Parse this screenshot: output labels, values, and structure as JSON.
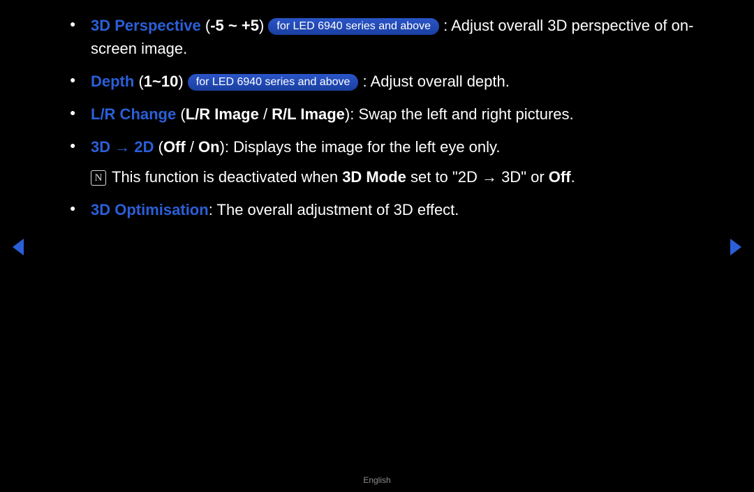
{
  "items": [
    {
      "title": "3D Perspective",
      "range_open": " (",
      "range": "-5 ~ +5",
      "range_close": ") ",
      "badge": "for LED 6940 series and above",
      "colon": " : ",
      "desc": "Adjust overall 3D perspective of on-screen image."
    },
    {
      "title": "Depth",
      "range_open": " (",
      "range": "1~10",
      "range_close": ") ",
      "badge": "for LED 6940 series and above",
      "colon": " : ",
      "desc": "Adjust overall depth."
    },
    {
      "title": "L/R Change",
      "paren_open": " (",
      "opt1": "L/R Image",
      "slash": " / ",
      "opt2": "R/L Image",
      "paren_close": "): ",
      "desc": "Swap the left and right pictures."
    },
    {
      "title": "3D → 2D",
      "paren_open": " (",
      "opt1": "Off",
      "slash": " / ",
      "opt2": "On",
      "paren_close": "): ",
      "desc": "Displays the image for the left eye only."
    },
    {
      "title": "3D Optimisation",
      "colon": ": ",
      "desc": "The overall adjustment of 3D effect."
    }
  ],
  "note": {
    "icon": "N",
    "pre": "This function is deactivated when ",
    "bold1": "3D Mode",
    "mid": " set to \"2D → 3D\" or ",
    "bold2": "Off",
    "post": "."
  },
  "footer": "English"
}
